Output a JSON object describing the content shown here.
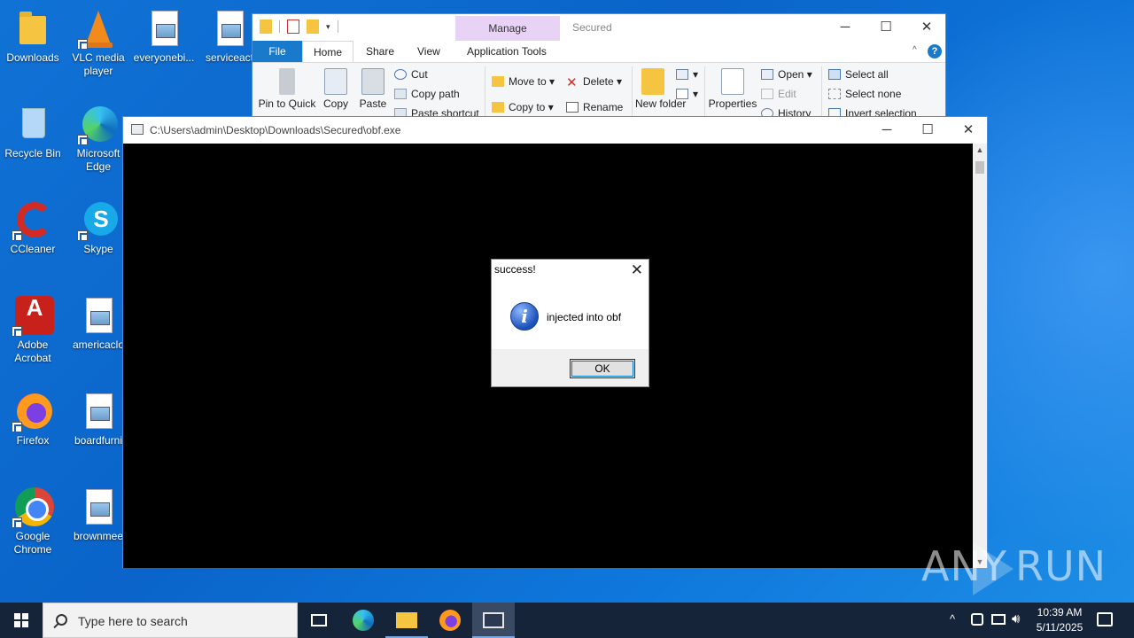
{
  "desktop_icons": [
    {
      "label": "Downloads"
    },
    {
      "label": "VLC media player"
    },
    {
      "label": "everyonebi..."
    },
    {
      "label": "serviceact"
    },
    {
      "label": "Recycle Bin"
    },
    {
      "label": "Microsoft Edge"
    },
    {
      "label": "CCleaner"
    },
    {
      "label": "Skype"
    },
    {
      "label": "Adobe Acrobat"
    },
    {
      "label": "americaclo"
    },
    {
      "label": "Firefox"
    },
    {
      "label": "boardfurni"
    },
    {
      "label": "Google Chrome"
    },
    {
      "label": "brownmee"
    }
  ],
  "explorer": {
    "manage_tab": "Manage",
    "title": "Secured",
    "tabs": [
      "File",
      "Home",
      "Share",
      "View",
      "Application Tools"
    ],
    "ribbon": {
      "pin": "Pin to Quick",
      "copy": "Copy",
      "paste": "Paste",
      "cut": "Cut",
      "copy_path": "Copy path",
      "paste_shortcut": "Paste shortcut",
      "move_to": "Move to",
      "copy_to": "Copy to",
      "delete": "Delete",
      "rename": "Rename",
      "new_folder": "New folder",
      "properties": "Properties",
      "open": "Open",
      "edit": "Edit",
      "history": "History",
      "select_all": "Select all",
      "select_none": "Select none",
      "invert_selection": "Invert selection"
    },
    "help": "?"
  },
  "console": {
    "title": "C:\\Users\\admin\\Desktop\\Downloads\\Secured\\obf.exe"
  },
  "msgbox": {
    "title": "success!",
    "message": "injected into obf",
    "ok_label": "OK",
    "close_glyph": "✕",
    "icon_glyph": "i"
  },
  "watermark": {
    "left": "ANY",
    "right": "RUN"
  },
  "taskbar": {
    "search_placeholder": "Type here to search",
    "time": "10:39 AM",
    "date": "5/11/2025"
  },
  "colors": {
    "desktop": "#0a64c9",
    "taskbar": "#16243a",
    "accent": "#1979ca",
    "manage_tab": "#e8d3f7"
  }
}
